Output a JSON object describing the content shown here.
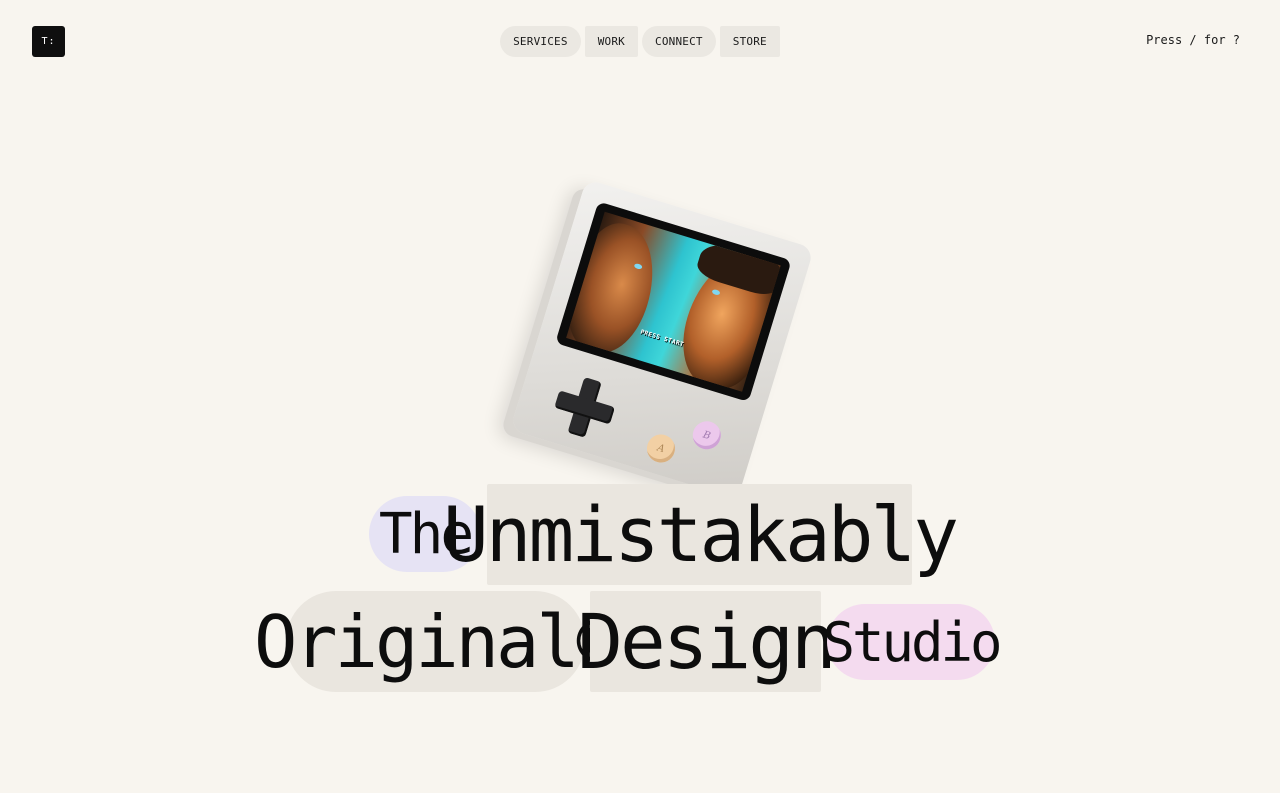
{
  "logo": {
    "text": "T:"
  },
  "nav": {
    "items": [
      {
        "label": "SERVICES",
        "shape": "pill"
      },
      {
        "label": "WORK",
        "shape": "square"
      },
      {
        "label": "CONNECT",
        "shape": "pill"
      },
      {
        "label": "STORE",
        "shape": "square"
      }
    ]
  },
  "hint": {
    "text": "Press / for ?"
  },
  "hero_image": {
    "screen_text": "PRESS START",
    "button_a": "A",
    "button_b": "B"
  },
  "headline": {
    "words": [
      "The",
      "Unmistakably",
      "Original®",
      "Design",
      "Studio"
    ]
  },
  "colors": {
    "background": "#f8f5ef",
    "chip_neutral": "#eae6df",
    "chip_lavender": "#e6e3f4",
    "chip_pink": "#f4dbef",
    "logo_bg": "#0f0f0f"
  }
}
